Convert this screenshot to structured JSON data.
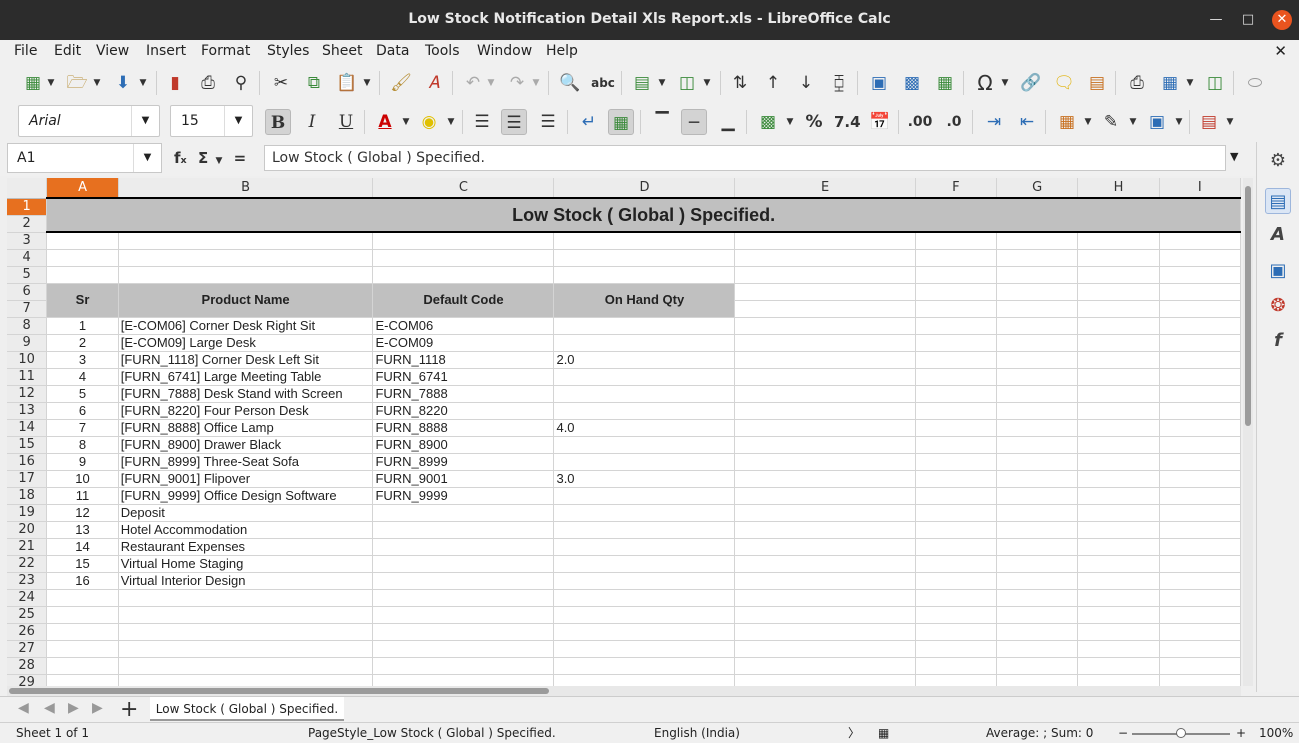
{
  "window": {
    "title": "Low Stock Notification Detail Xls Report.xls - LibreOffice Calc"
  },
  "menu": [
    "File",
    "Edit",
    "View",
    "Insert",
    "Format",
    "Styles",
    "Sheet",
    "Data",
    "Tools",
    "Window",
    "Help"
  ],
  "font": {
    "name": "Arial",
    "size": "15"
  },
  "formula_bar": {
    "cell_ref": "A1",
    "content": "Low Stock ( Global ) Specified."
  },
  "columns": [
    "A",
    "B",
    "C",
    "D",
    "E",
    "F",
    "G",
    "H",
    "I"
  ],
  "banner": "Low Stock ( Global ) Specified.",
  "table_headers": {
    "sr": "Sr",
    "product": "Product Name",
    "code": "Default Code",
    "qty": "On Hand Qty"
  },
  "rows": [
    {
      "sr": "1",
      "product": "[E-COM06] Corner Desk Right Sit",
      "code": "E-COM06",
      "qty": ""
    },
    {
      "sr": "2",
      "product": "[E-COM09] Large Desk",
      "code": "E-COM09",
      "qty": ""
    },
    {
      "sr": "3",
      "product": "[FURN_1118] Corner Desk Left Sit",
      "code": "FURN_1118",
      "qty": "2.0"
    },
    {
      "sr": "4",
      "product": "[FURN_6741] Large Meeting Table",
      "code": "FURN_6741",
      "qty": ""
    },
    {
      "sr": "5",
      "product": "[FURN_7888] Desk Stand with Screen",
      "code": "FURN_7888",
      "qty": ""
    },
    {
      "sr": "6",
      "product": "[FURN_8220] Four Person Desk",
      "code": "FURN_8220",
      "qty": ""
    },
    {
      "sr": "7",
      "product": "[FURN_8888] Office Lamp",
      "code": "FURN_8888",
      "qty": "4.0"
    },
    {
      "sr": "8",
      "product": "[FURN_8900] Drawer Black",
      "code": "FURN_8900",
      "qty": ""
    },
    {
      "sr": "9",
      "product": "[FURN_8999] Three-Seat Sofa",
      "code": "FURN_8999",
      "qty": ""
    },
    {
      "sr": "10",
      "product": "[FURN_9001] Flipover",
      "code": "FURN_9001",
      "qty": "3.0"
    },
    {
      "sr": "11",
      "product": "[FURN_9999] Office Design Software",
      "code": "FURN_9999",
      "qty": ""
    },
    {
      "sr": "12",
      "product": "Deposit",
      "code": "",
      "qty": ""
    },
    {
      "sr": "13",
      "product": "Hotel Accommodation",
      "code": "",
      "qty": ""
    },
    {
      "sr": "14",
      "product": "Restaurant Expenses",
      "code": "",
      "qty": ""
    },
    {
      "sr": "15",
      "product": "Virtual Home Staging",
      "code": "",
      "qty": ""
    },
    {
      "sr": "16",
      "product": "Virtual Interior Design",
      "code": "",
      "qty": ""
    }
  ],
  "row_numbers": [
    "1",
    "2",
    "3",
    "4",
    "5",
    "6",
    "7",
    "8",
    "9",
    "10",
    "11",
    "12",
    "13",
    "14",
    "15",
    "16",
    "17",
    "18",
    "19",
    "20",
    "21",
    "22",
    "23",
    "24",
    "25",
    "26",
    "27",
    "28",
    "29"
  ],
  "sheet_tab": "Low Stock ( Global ) Specified.",
  "status": {
    "sheet": "Sheet 1 of 1",
    "page_style": "PageStyle_Low Stock ( Global ) Specified.",
    "language": "English (India)",
    "summary": "Average: ; Sum: 0",
    "zoom": "100%"
  },
  "colors": {
    "selected_header": "#e7701f",
    "header_fill": "#c0c0c0",
    "titlebar": "#2c2c2c"
  }
}
